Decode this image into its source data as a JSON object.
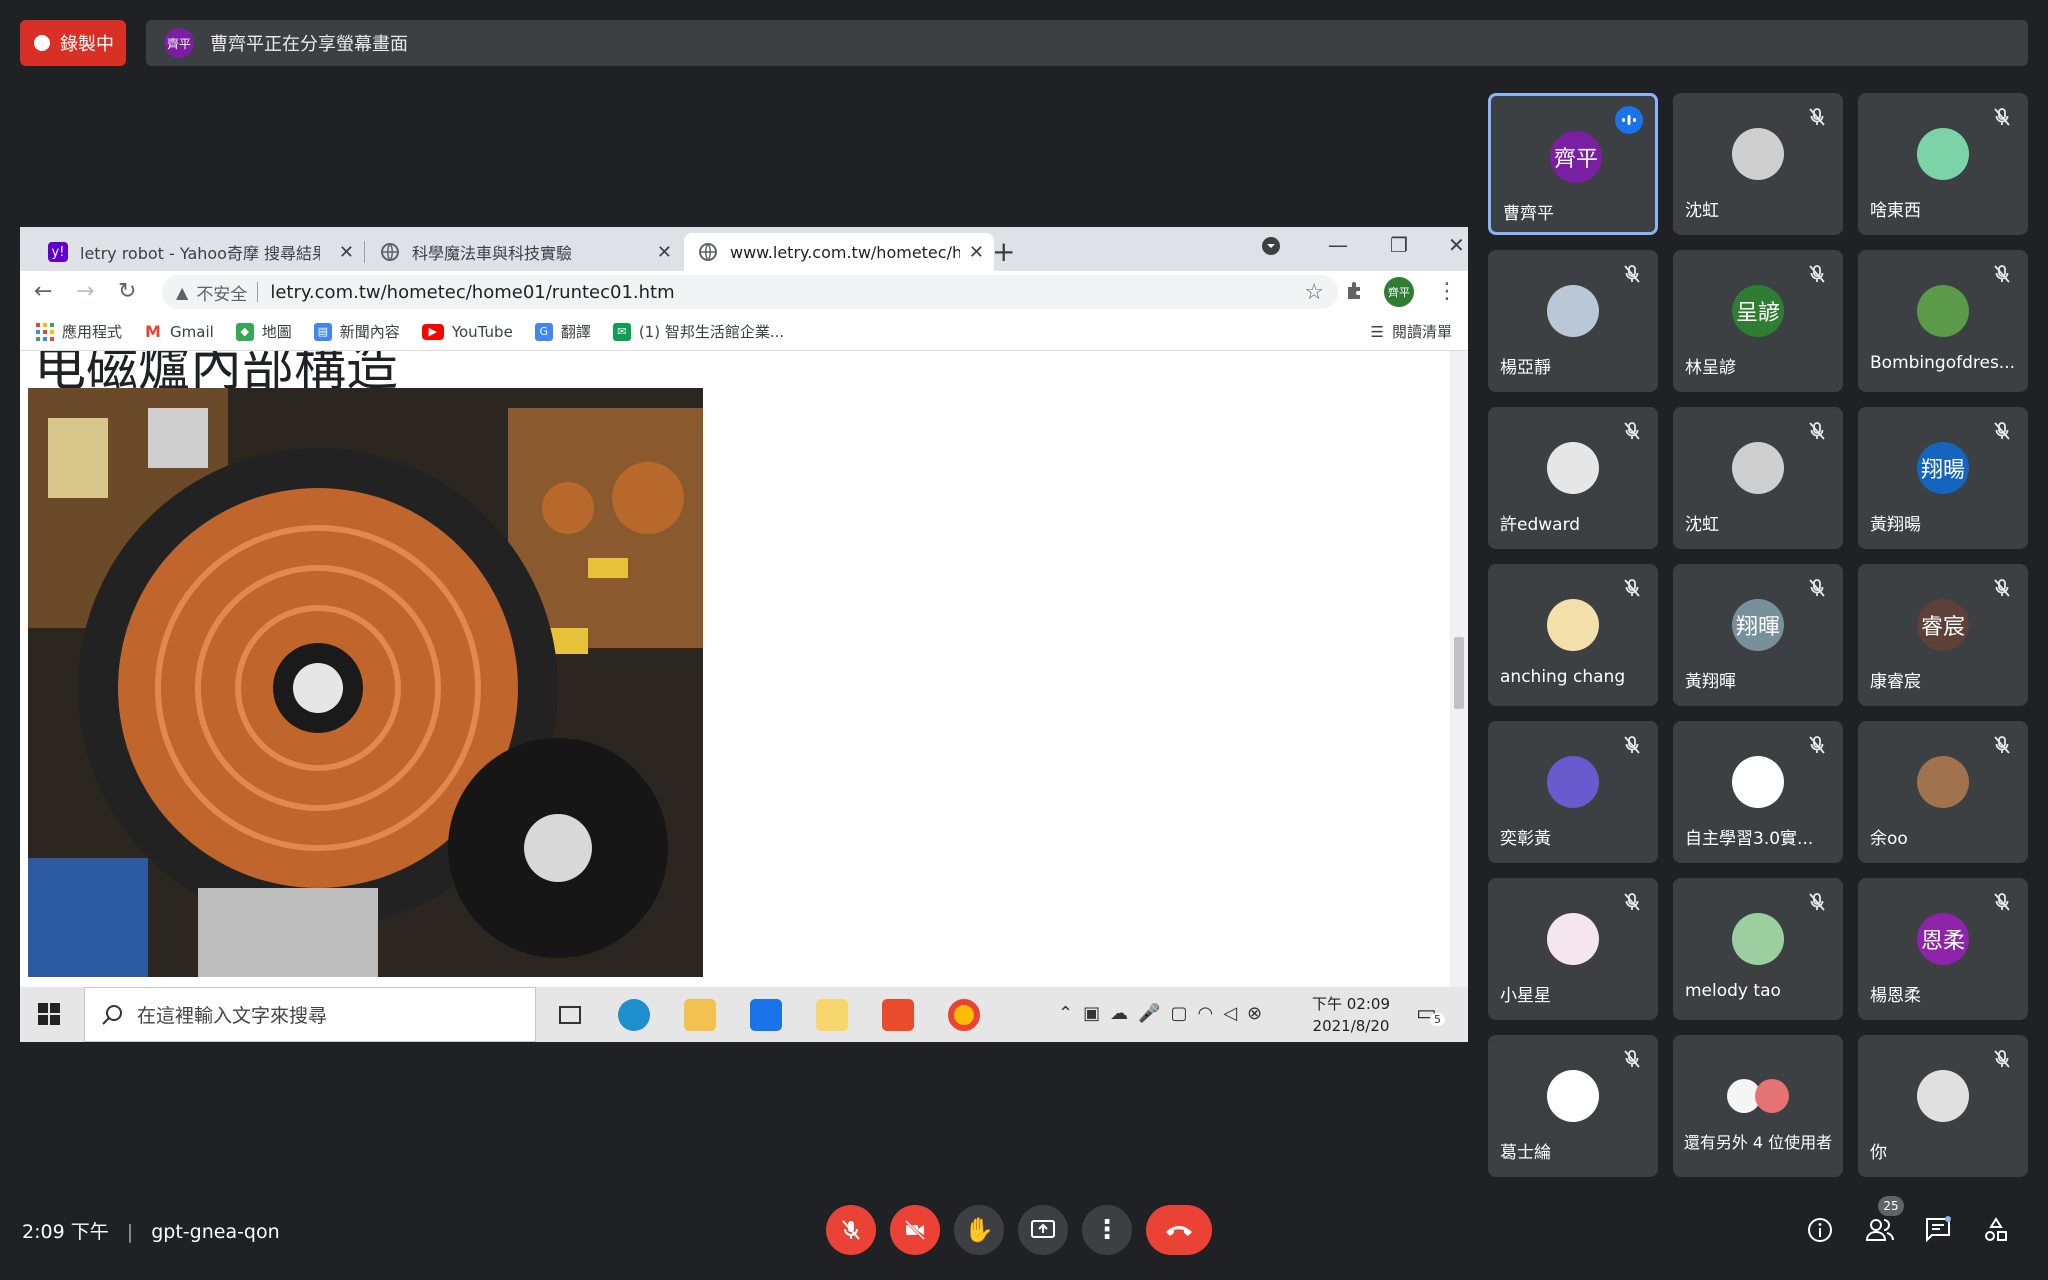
{
  "recording": {
    "label": "錄製中"
  },
  "share_banner": {
    "avatar_text": "齊平",
    "text": "曹齊平正在分享螢幕畫面"
  },
  "browser": {
    "tabs": [
      {
        "title": "letry robot - Yahoo奇摩 搜尋結果",
        "favicon": "yahoo-icon",
        "favicon_text": "y!",
        "favicon_color": "#6001d2"
      },
      {
        "title": "科學魔法車與科技實驗",
        "favicon": "globe-icon",
        "favicon_text": "",
        "favicon_color": "#5f6368"
      },
      {
        "title": "www.letry.com.tw/hometec/ho",
        "favicon": "globe-icon",
        "favicon_text": "",
        "favicon_color": "#5f6368"
      }
    ],
    "address": {
      "security_label": "不安全",
      "url": "letry.com.tw/hometec/home01/runtec01.htm"
    },
    "profile_text": "齊平",
    "bookmarks": [
      {
        "label": "應用程式",
        "icon": "apps-grid-icon",
        "color": "#ea4335"
      },
      {
        "label": "Gmail",
        "icon": "gmail-icon",
        "color": "#ea4335"
      },
      {
        "label": "地圖",
        "icon": "maps-icon",
        "color": "#34a853"
      },
      {
        "label": "新聞內容",
        "icon": "news-icon",
        "color": "#4285f4"
      },
      {
        "label": "YouTube",
        "icon": "youtube-icon",
        "color": "#ff0000"
      },
      {
        "label": "翻譯",
        "icon": "translate-icon",
        "color": "#4285f4"
      },
      {
        "label": "(1) 智邦生活館企業...",
        "icon": "mail-icon",
        "color": "#0f9d58"
      }
    ],
    "reading_list": "閱讀清單",
    "page_heading": "电磁爐內部構造"
  },
  "taskbar": {
    "search_placeholder": "在這裡輸入文字來搜尋",
    "time": "下午 02:09",
    "date": "2021/8/20",
    "notification_count": "5"
  },
  "participants": [
    {
      "name": "曹齊平",
      "avatar_text": "齊平",
      "color": "#7b1fa2",
      "speaking": true
    },
    {
      "name": "沈虹",
      "avatar_text": "",
      "color": "#cfcfcf",
      "speaking": false
    },
    {
      "name": "啥東西",
      "avatar_text": "",
      "color": "#7dd3a8",
      "speaking": false
    },
    {
      "name": "楊亞靜",
      "avatar_text": "",
      "color": "#b9c7d6",
      "speaking": false
    },
    {
      "name": "林呈諺",
      "avatar_text": "呈諺",
      "color": "#2e7d32",
      "speaking": false
    },
    {
      "name": "Bombingofdres...",
      "avatar_text": "",
      "color": "#5a9a48",
      "speaking": false
    },
    {
      "name": "許edward",
      "avatar_text": "",
      "color": "#e6e6e6",
      "speaking": false
    },
    {
      "name": "沈虹",
      "avatar_text": "",
      "color": "#cfcfcf",
      "speaking": false
    },
    {
      "name": "黃翔暘",
      "avatar_text": "翔暘",
      "color": "#1565c0",
      "speaking": false
    },
    {
      "name": "anching chang",
      "avatar_text": "",
      "color": "#f3dfa9",
      "speaking": false
    },
    {
      "name": "黃翔暉",
      "avatar_text": "翔暉",
      "color": "#78909c",
      "speaking": false
    },
    {
      "name": "康睿宸",
      "avatar_text": "睿宸",
      "color": "#5d4037",
      "speaking": false
    },
    {
      "name": "奕彰黃",
      "avatar_text": "",
      "color": "#6a5acd",
      "speaking": false
    },
    {
      "name": "自主學習3.0實...",
      "avatar_text": "",
      "color": "#ffffff",
      "speaking": false
    },
    {
      "name": "余oo",
      "avatar_text": "",
      "color": "#a0724e",
      "speaking": false
    },
    {
      "name": "小星星",
      "avatar_text": "",
      "color": "#f5e6ee",
      "speaking": false
    },
    {
      "name": "melody tao",
      "avatar_text": "",
      "color": "#9ccfa0",
      "speaking": false
    },
    {
      "name": "楊恩柔",
      "avatar_text": "恩柔",
      "color": "#8e24aa",
      "speaking": false
    },
    {
      "name": "葛士綸",
      "avatar_text": "",
      "color": "#ffffff",
      "speaking": false
    },
    {
      "name": "還有另外 4 位使用者",
      "avatar_text": "",
      "color": "#e57373",
      "speaking": false
    },
    {
      "name": "你",
      "avatar_text": "",
      "color": "#e0e0e0",
      "speaking": false
    }
  ],
  "meeting": {
    "time": "2:09 下午",
    "separator": "|",
    "code": "gpt-gnea-qon",
    "people_count": "25"
  },
  "colors": {
    "red": "#ea4335",
    "bg": "#202124",
    "tile": "#3c4043",
    "accent": "#8ab4f8"
  }
}
